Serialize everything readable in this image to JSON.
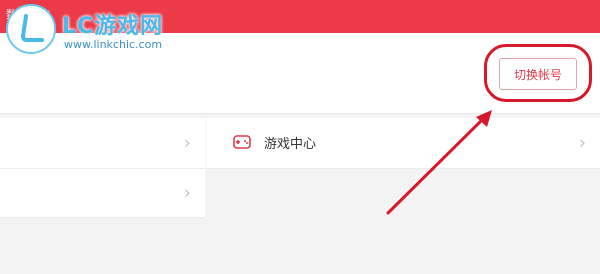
{
  "header": {
    "text": "数据工作"
  },
  "account": {
    "switch_button_label": "切换帐号"
  },
  "menu": {
    "chevron": "›",
    "game_center_label": "游戏中心",
    "game_center_icon": "gamepad-icon"
  },
  "watermark": {
    "title": "LC游戏网",
    "url": "www.linkchic.com"
  },
  "colors": {
    "header_red": "#ec3a48",
    "annotation_red": "#d7182a",
    "logo_blue": "#49b9ea"
  }
}
